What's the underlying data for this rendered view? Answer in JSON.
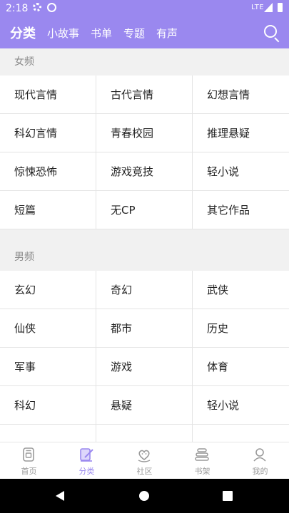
{
  "status": {
    "time": "2:18",
    "network": "LTE"
  },
  "nav": {
    "tabs": [
      {
        "label": "分类",
        "active": true
      },
      {
        "label": "小故事"
      },
      {
        "label": "书单"
      },
      {
        "label": "专题"
      },
      {
        "label": "有声"
      }
    ]
  },
  "sections": [
    {
      "title": "女频",
      "items": [
        "现代言情",
        "古代言情",
        "幻想言情",
        "科幻言情",
        "青春校园",
        "推理悬疑",
        "惊悚恐怖",
        "游戏竞技",
        "轻小说",
        "短篇",
        "无CP",
        "其它作品"
      ]
    },
    {
      "title": "男频",
      "items": [
        "玄幻",
        "奇幻",
        "武侠",
        "仙侠",
        "都市",
        "历史",
        "军事",
        "游戏",
        "体育",
        "科幻",
        "悬疑",
        "轻小说"
      ]
    }
  ],
  "bottom_tabs": [
    {
      "label": "首页",
      "icon": "home-book-icon"
    },
    {
      "label": "分类",
      "icon": "category-pen-icon",
      "active": true
    },
    {
      "label": "社区",
      "icon": "community-heart-icon"
    },
    {
      "label": "书架",
      "icon": "bookshelf-stack-icon"
    },
    {
      "label": "我的",
      "icon": "profile-icon"
    }
  ],
  "colors": {
    "accent": "#9a88ef",
    "inactive": "#9a9a9a",
    "divider": "#e4e4e4"
  }
}
